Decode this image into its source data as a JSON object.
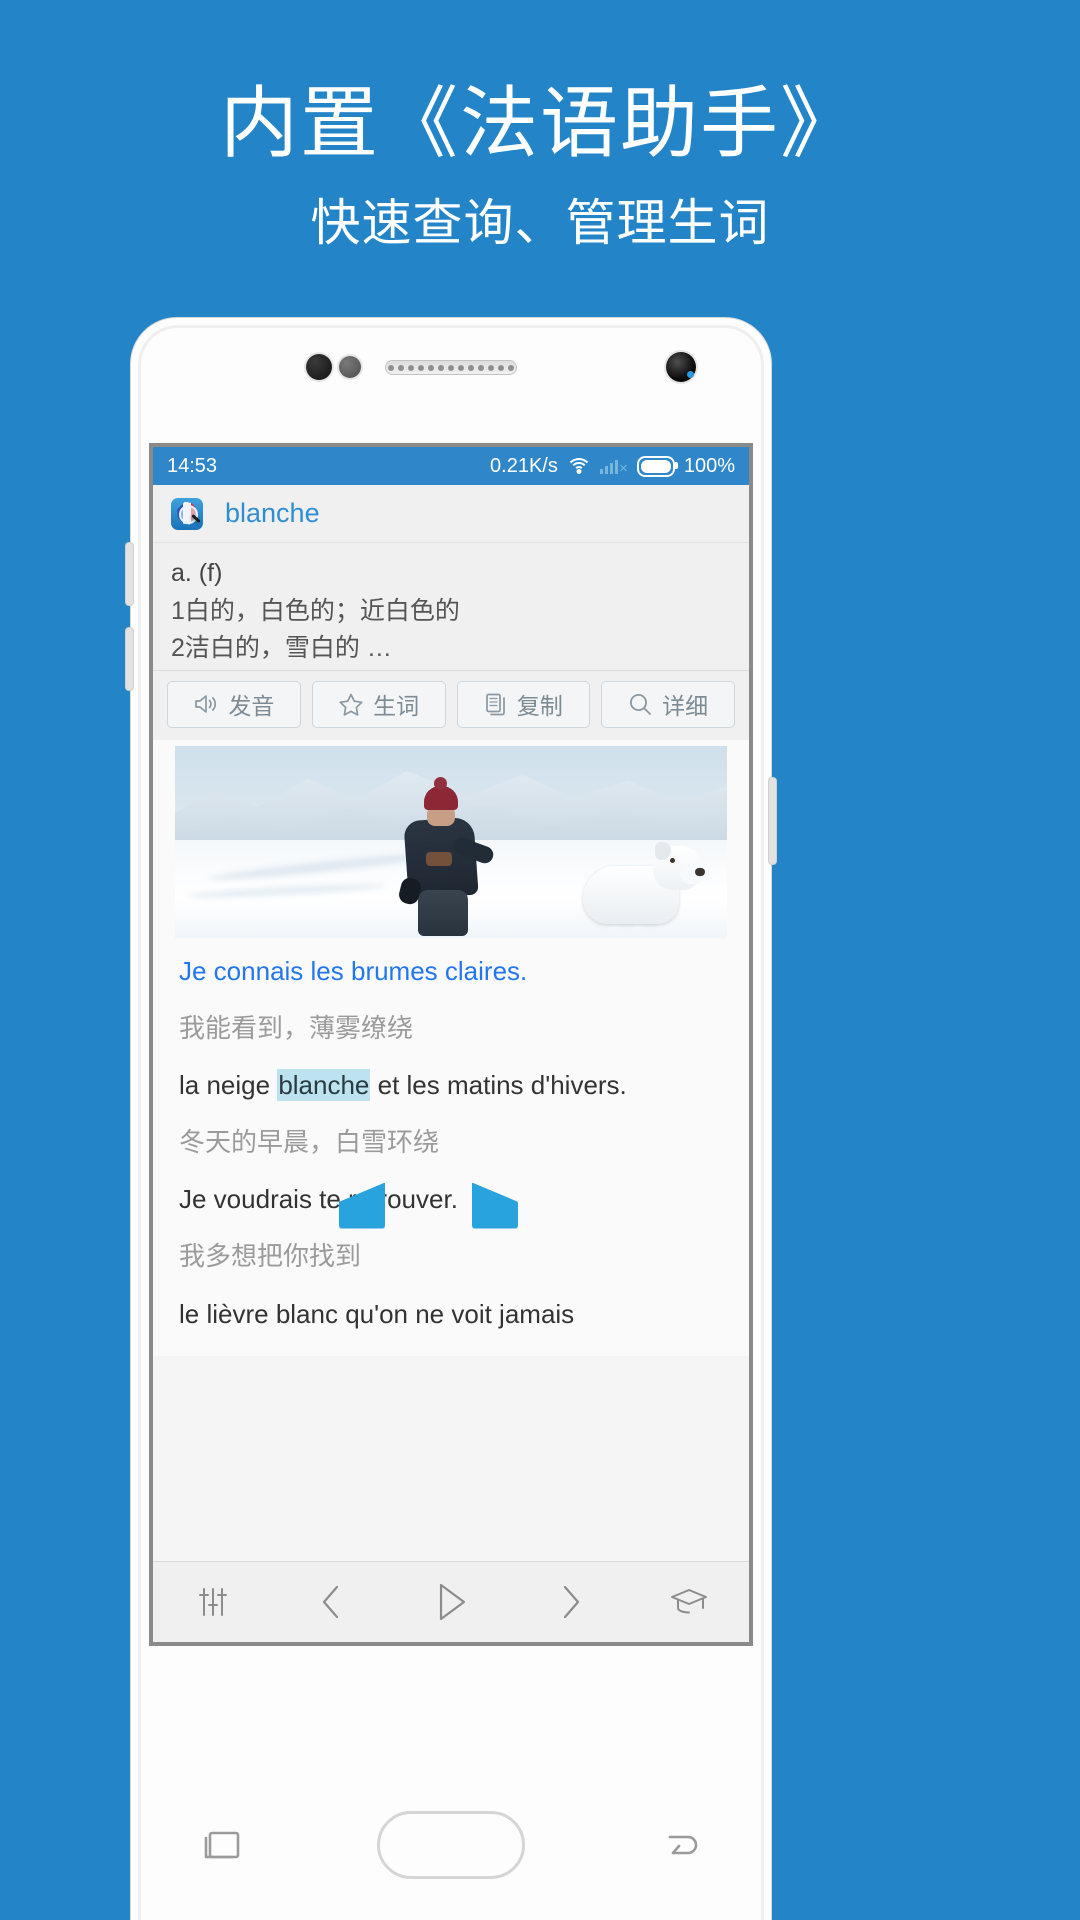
{
  "promo": {
    "title": "内置《法语助手》",
    "subtitle": "快速查询、管理生词"
  },
  "colors": {
    "background": "#2385c8",
    "status_bar": "#2f87c9",
    "accent_link": "#2277ee",
    "app_title": "#2f8ed1",
    "highlight": "#bde3f0",
    "handle": "#29a3dd"
  },
  "phone": {
    "status_bar": {
      "time": "14:53",
      "network_speed": "0.21K/s",
      "wifi_icon": "wifi-icon",
      "signal_icon": "signal-no-service-icon",
      "battery_icon": "battery-full-icon",
      "battery_percent": "100%"
    },
    "app_header": {
      "icon": "french-dictionary-icon",
      "title": "blanche"
    },
    "definition": {
      "pos": "a. (f)",
      "sense_1": "1白的，白色的；近白色的",
      "sense_2": "2洁白的，雪白的 …"
    },
    "actions": [
      {
        "label": "发音",
        "icon": "speaker-icon"
      },
      {
        "label": "生词",
        "icon": "star-icon"
      },
      {
        "label": "复制",
        "icon": "copy-icon"
      },
      {
        "label": "详细",
        "icon": "search-icon"
      }
    ],
    "content": {
      "image_alt": "person-walking-with-white-dog-in-snow",
      "lines": [
        {
          "text": "Je connais les brumes claires.",
          "style": "fr-hi"
        },
        {
          "text": "我能看到，薄雾缭绕",
          "style": "cn"
        },
        {
          "text_before": "la neige ",
          "highlight": "blanche",
          "text_after": " et les matins d'hivers.",
          "style": "fr"
        },
        {
          "text": "冬天的早晨，白雪环绕",
          "style": "cn"
        },
        {
          "text": "Je voudrais te retrouver.",
          "style": "fr"
        },
        {
          "text": "我多想把你找到",
          "style": "cn"
        },
        {
          "text": "le lièvre blanc qu'on ne voit jamais",
          "style": "fr"
        }
      ]
    },
    "toolbar": [
      {
        "icon": "settings-sliders-icon"
      },
      {
        "icon": "chevron-left-icon"
      },
      {
        "icon": "play-icon"
      },
      {
        "icon": "chevron-right-icon"
      },
      {
        "icon": "graduation-cap-icon"
      }
    ],
    "navbar": [
      {
        "icon": "recents-icon"
      },
      {
        "icon": "home-icon"
      },
      {
        "icon": "back-icon"
      }
    ]
  }
}
